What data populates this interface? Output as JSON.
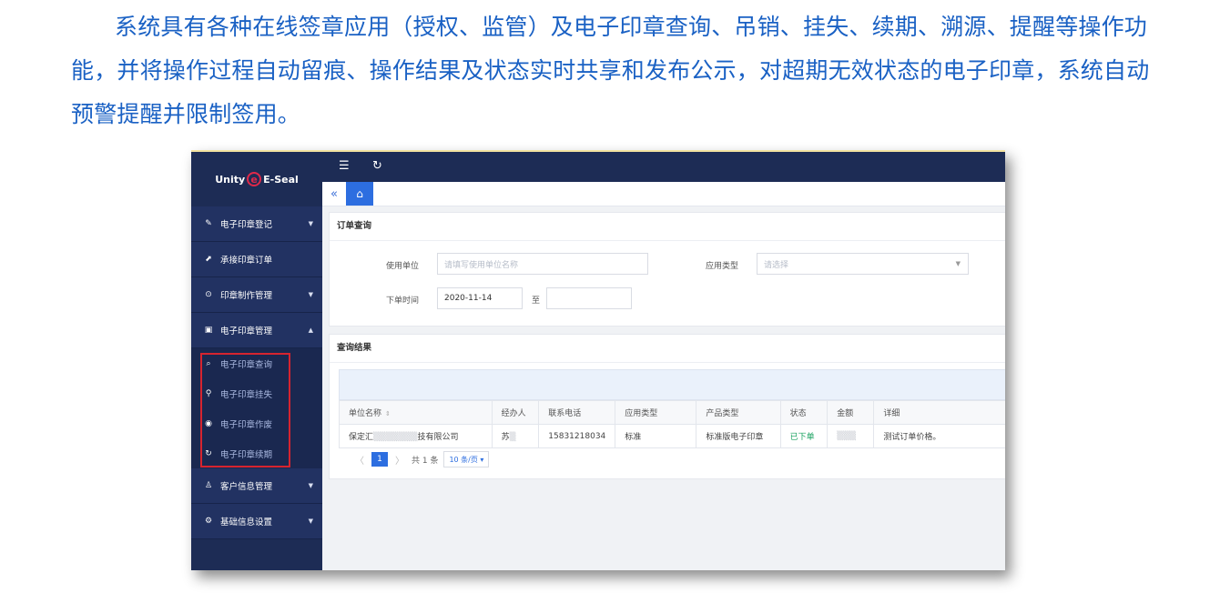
{
  "caption": "系统具有各种在线签章应用（授权、监管）及电子印章查询、吊销、挂失、续期、溯源、提醒等操作功能，并将操作过程自动留痕、操作结果及状态实时共享和发布公示，对超期无效状态的电子印章，系统自动预警提醒并限制签用。",
  "app": {
    "logo_left": "Unity",
    "logo_mark": "e",
    "logo_right": "E-Seal"
  },
  "colors": {
    "sidebar": "#1d2c55",
    "accent": "#2d6ee0",
    "caption": "#1a61c4",
    "highlight_frame": "#d6242f",
    "status_ok": "#19a15f"
  },
  "header": {
    "menu_icon": "☰",
    "refresh_icon": "↻",
    "collapse_icon": "«",
    "home_icon": "⌂"
  },
  "sidebar": {
    "items": [
      {
        "label": "电子印章登记",
        "icon": "✎",
        "chevron": "▼"
      },
      {
        "label": "承接印章订单",
        "icon": "⬈"
      },
      {
        "label": "印章制作管理",
        "icon": "⊙",
        "chevron": "▼"
      },
      {
        "label": "电子印章管理",
        "icon": "▣",
        "chevron": "▲"
      }
    ],
    "subitems": [
      {
        "label": "电子印章查询",
        "icon": "⌕"
      },
      {
        "label": "电子印章挂失",
        "icon": "⚲"
      },
      {
        "label": "电子印章作废",
        "icon": "◉"
      },
      {
        "label": "电子印章续期",
        "icon": "↻"
      }
    ],
    "items_after": [
      {
        "label": "客户信息管理",
        "icon": "♙",
        "chevron": "▼"
      },
      {
        "label": "基础信息设置",
        "icon": "⚙",
        "chevron": "▼"
      }
    ]
  },
  "query": {
    "title": "订单查询",
    "unit_label": "使用单位",
    "unit_placeholder": "请填写使用单位名称",
    "type_label": "应用类型",
    "type_placeholder": "请选择",
    "date_label": "下单时间",
    "date_from": "2020-11-14",
    "date_sep": "至",
    "date_to": ""
  },
  "results": {
    "title": "查询结果",
    "columns": [
      "单位名称",
      "经办人",
      "联系电话",
      "应用类型",
      "产品类型",
      "状态",
      "金额",
      "详细"
    ],
    "rows": [
      {
        "unit_a": "保定汇",
        "unit_b": "▒▒▒▒▒▒▒",
        "unit_c": "技有限公司",
        "handler": "苏",
        "handler_blur": "▒",
        "phone": "15831218034",
        "app_type": "标准",
        "product": "标准版电子印章",
        "status": "已下单",
        "amount": "▒▒▒",
        "detail": "测试订单价格。"
      }
    ],
    "pager": {
      "prev": "〈",
      "page": "1",
      "next": "〉",
      "total": "共 1 条",
      "size": "10 条/页 ▾"
    }
  }
}
